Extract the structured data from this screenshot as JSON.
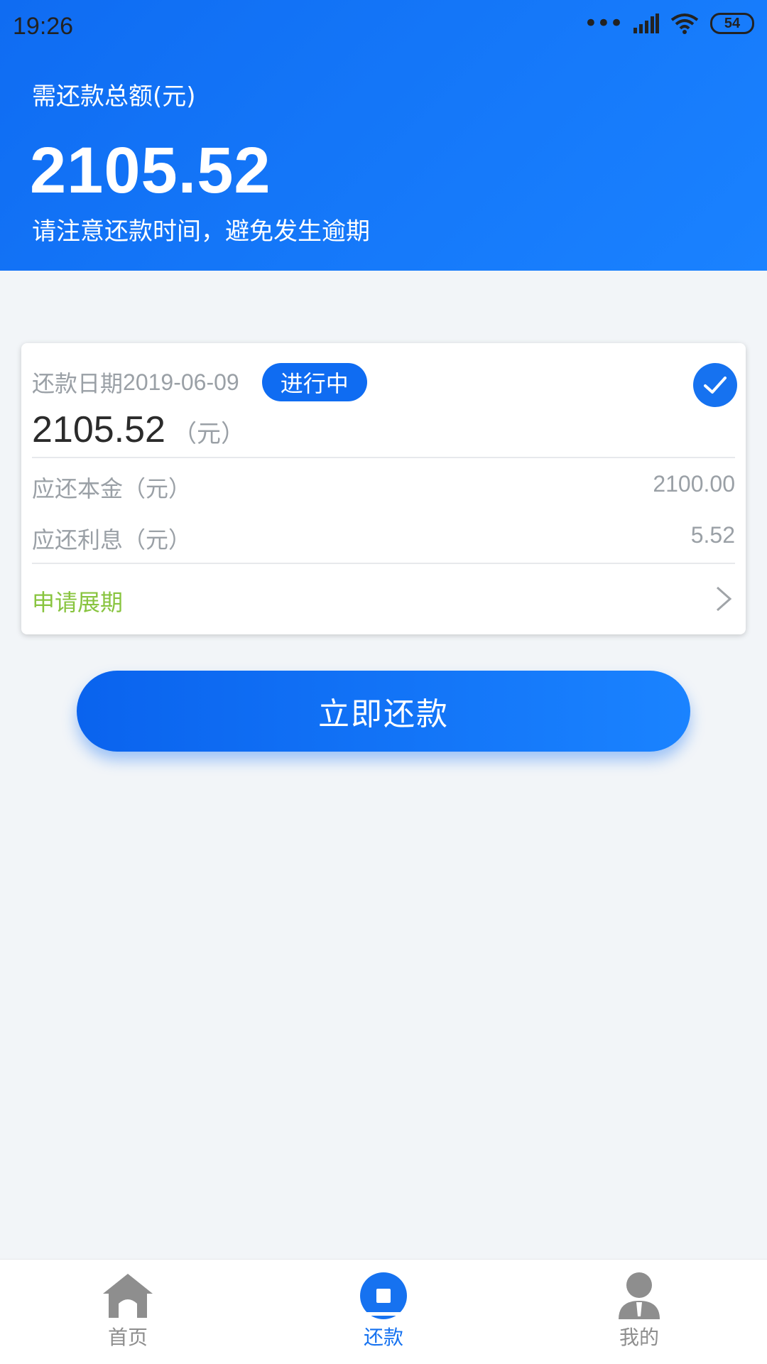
{
  "status": {
    "time": "19:26",
    "battery": "54",
    "icons": [
      "dots-icon",
      "signal-icon",
      "wifi-icon",
      "battery-icon"
    ]
  },
  "header": {
    "label": "需还款总额(元)",
    "amount": "2105.52",
    "note": "请注意还款时间，避免发生逾期"
  },
  "card": {
    "date_label": "还款日期",
    "date_value": "2019-06-09",
    "status_badge": "进行中",
    "amount": "2105.52",
    "amount_unit": "（元）",
    "rows": [
      {
        "label": "应还本金（元）",
        "value": "2100.00"
      },
      {
        "label": "应还利息（元）",
        "value": "5.52"
      }
    ],
    "apply_label": "申请展期"
  },
  "pay_button": "立即还款",
  "nav": {
    "items": [
      {
        "label": "首页",
        "icon": "home-icon",
        "active": false
      },
      {
        "label": "还款",
        "icon": "repay-icon",
        "active": true
      },
      {
        "label": "我的",
        "icon": "user-icon",
        "active": false
      }
    ]
  },
  "colors": {
    "primary": "#1672f0",
    "accent_green": "#88c43f",
    "muted_text": "#9aa0a6",
    "background": "#f2f5f8"
  }
}
